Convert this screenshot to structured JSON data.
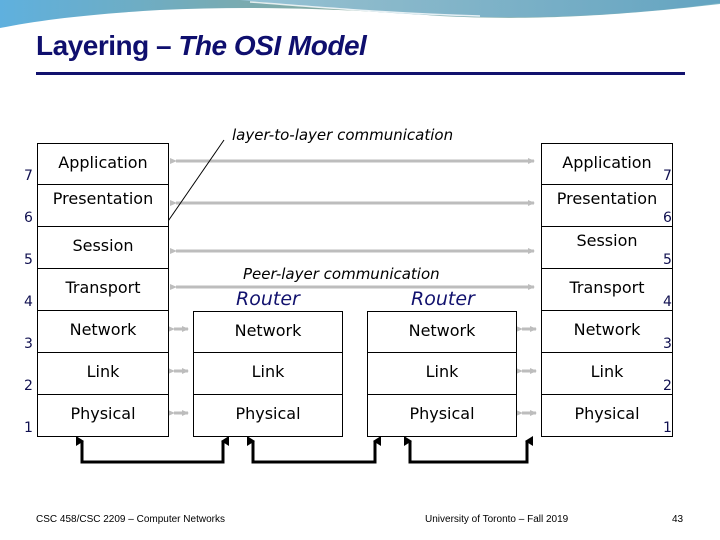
{
  "slide": {
    "title_plain": "Layering – ",
    "title_italic": "The OSI Model",
    "captions": {
      "layer_to_layer": "layer-to-layer communication",
      "peer_layer": "Peer-layer communication"
    },
    "end_host_left": {
      "layers": [
        {
          "num": "7",
          "label": "Application"
        },
        {
          "num": "6",
          "label": "Presentation"
        },
        {
          "num": "5",
          "label": "Session"
        },
        {
          "num": "4",
          "label": "Transport"
        },
        {
          "num": "3",
          "label": "Network"
        },
        {
          "num": "2",
          "label": "Link"
        },
        {
          "num": "1",
          "label": "Physical"
        }
      ]
    },
    "end_host_right": {
      "layers": [
        {
          "num": "7",
          "label": "Application"
        },
        {
          "num": "6",
          "label": "Presentation"
        },
        {
          "num": "5",
          "label": "Session"
        },
        {
          "num": "4",
          "label": "Transport"
        },
        {
          "num": "3",
          "label": "Network"
        },
        {
          "num": "2",
          "label": "Link"
        },
        {
          "num": "1",
          "label": "Physical"
        }
      ]
    },
    "routers": [
      {
        "title": "Router",
        "layers": [
          "Network",
          "Link",
          "Physical"
        ]
      },
      {
        "title": "Router",
        "layers": [
          "Network",
          "Link",
          "Physical"
        ]
      }
    ],
    "colors": {
      "title": "#0f0f6e",
      "router_title": "#12126e",
      "peer_arrow": "#bdbdbd",
      "physical_link": "#000000"
    }
  },
  "footer": {
    "course": "CSC 458/CSC 2209 – Computer Networks",
    "university": "University of Toronto – Fall 2019",
    "page": "43"
  }
}
